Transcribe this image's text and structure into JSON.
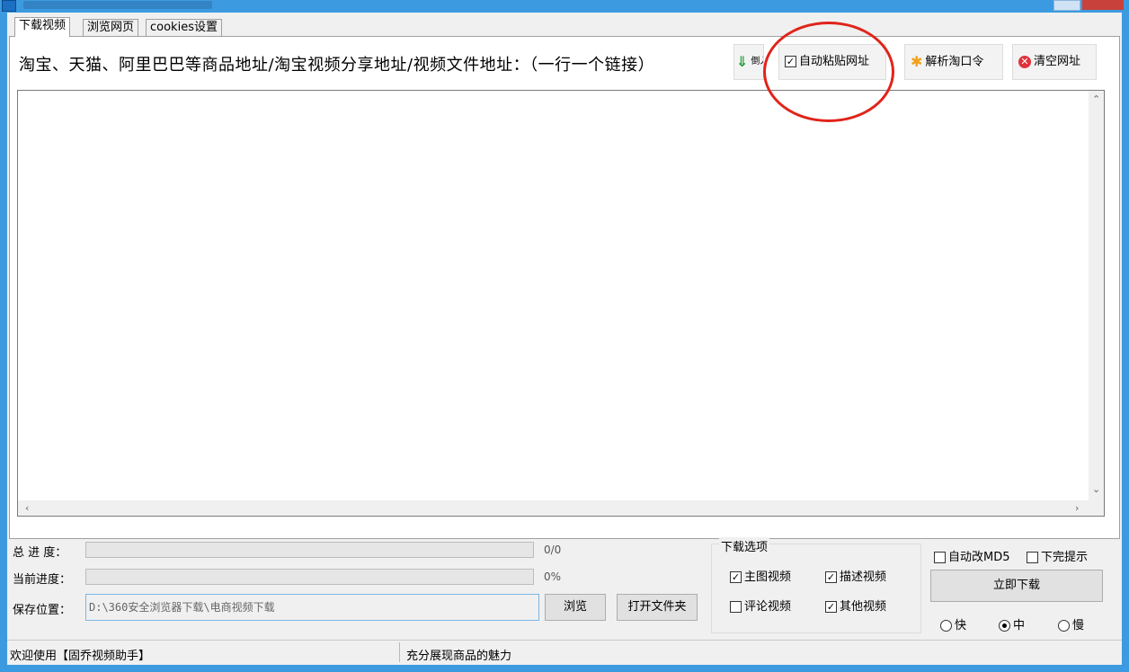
{
  "tabs": [
    "下载视频",
    "浏览网页",
    "cookies设置"
  ],
  "heading": "淘宝、天猫、阿里巴巴等商品地址/淘宝视频分享地址/视频文件地址：（一行一个链接）",
  "toolbar": {
    "import_label": "倒入",
    "auto_paste": {
      "label": "自动粘贴网址",
      "checked": true
    },
    "parse_label": "解析淘口令",
    "clear_label": "清空网址"
  },
  "progress": {
    "total_label": "总 进 度：",
    "total_value": "0/0",
    "total_fraction": 0,
    "current_label": "当前进度：",
    "current_value": "0%",
    "current_fraction": 0
  },
  "save": {
    "label": "保存位置：",
    "path": "D:\\360安全浏览器下载\\电商视频下载",
    "browse_label": "浏览",
    "open_folder_label": "打开文件夹"
  },
  "download_options": {
    "title": "下载选项",
    "main_video": {
      "label": "主图视频",
      "checked": true
    },
    "desc_video": {
      "label": "描述视频",
      "checked": true
    },
    "review_video": {
      "label": "评论视频",
      "checked": false
    },
    "other_video": {
      "label": "其他视频",
      "checked": true
    }
  },
  "right_panel": {
    "auto_md5": {
      "label": "自动改MD5",
      "checked": false
    },
    "done_notice": {
      "label": "下完提示",
      "checked": false
    },
    "download_now_label": "立即下载",
    "speed_options": [
      "快",
      "中",
      "慢"
    ],
    "speed_selected": "中"
  },
  "status": {
    "left": "欢迎使用【固乔视频助手】",
    "right": "充分展现商品的魅力"
  },
  "colors": {
    "titlebar": "#3c9be0",
    "annotation": "#e0241a",
    "progress_fill": "#06b025"
  },
  "icons": {
    "import": "down-arrow-icon",
    "parse": "asterisk-icon",
    "clear": "red-x-icon"
  }
}
